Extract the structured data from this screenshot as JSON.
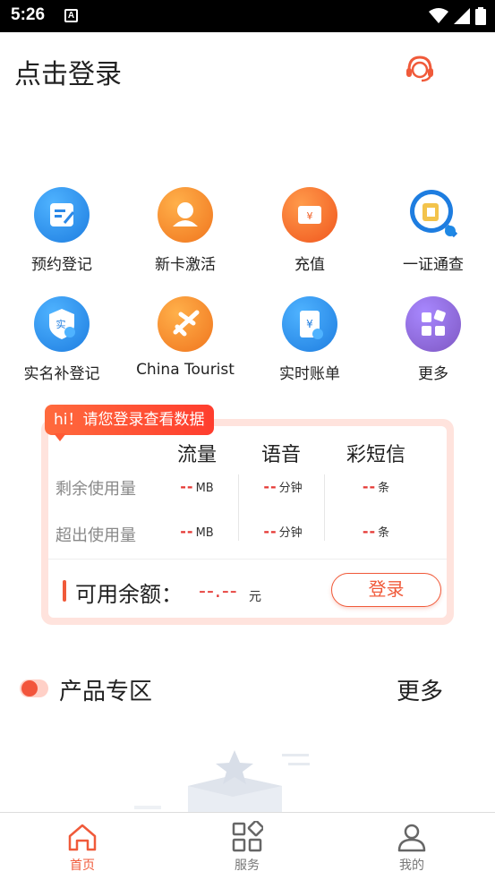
{
  "status_bar": {
    "time": "5:26",
    "notification_glyph": "A",
    "icons": [
      "wifi-icon",
      "signal-icon",
      "battery-icon"
    ]
  },
  "header": {
    "title": "点击登录",
    "support_icon": "headset-icon"
  },
  "services": [
    {
      "label": "预约登记",
      "icon": "form-icon",
      "color": "#1e88e5"
    },
    {
      "label": "新卡激活",
      "icon": "user-icon",
      "color": "#f57c00"
    },
    {
      "label": "充值",
      "icon": "wallet-icon",
      "color": "#f4511e"
    },
    {
      "label": "一证通查",
      "icon": "id-search-icon",
      "color": "#1e88e5"
    },
    {
      "label": "实名补登记",
      "icon": "shield-check-icon",
      "color": "#1e88e5"
    },
    {
      "label": "China Tourist",
      "icon": "airplane-icon",
      "color": "#f57c00"
    },
    {
      "label": "实时账单",
      "icon": "bill-icon",
      "color": "#1e88e5"
    },
    {
      "label": "更多",
      "icon": "more-apps-icon",
      "color": "#7e57c2"
    }
  ],
  "usage": {
    "banner": "hi！请您登录查看数据",
    "columns": [
      "流量",
      "语音",
      "彩短信"
    ],
    "rows": [
      {
        "label": "剩余使用量",
        "values": [
          {
            "value": "--",
            "unit": "MB"
          },
          {
            "value": "--",
            "unit": "分钟"
          },
          {
            "value": "--",
            "unit": "条"
          }
        ]
      },
      {
        "label": "超出使用量",
        "values": [
          {
            "value": "--",
            "unit": "MB"
          },
          {
            "value": "--",
            "unit": "分钟"
          },
          {
            "value": "--",
            "unit": "条"
          }
        ]
      }
    ],
    "balance_label": "可用余额：",
    "balance_value": "--.--",
    "balance_unit": "元",
    "login_button": "登录"
  },
  "products": {
    "title": "产品专区",
    "more": "更多"
  },
  "bottom_nav": [
    {
      "label": "首页",
      "icon": "home-icon",
      "active": true
    },
    {
      "label": "服务",
      "icon": "grid-icon",
      "active": false
    },
    {
      "label": "我的",
      "icon": "profile-icon",
      "active": false
    }
  ],
  "colors": {
    "accent": "#f05a3a",
    "dash_red": "#e53935"
  }
}
